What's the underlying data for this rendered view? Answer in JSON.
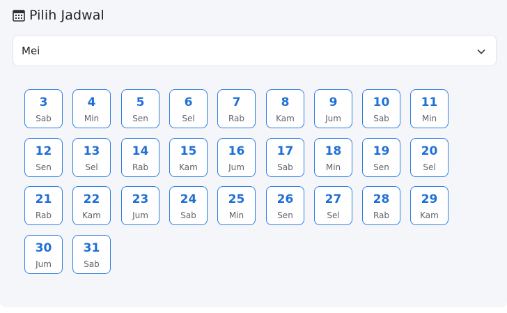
{
  "header": {
    "title": "Pilih Jadwal",
    "icon": "calendar-icon"
  },
  "month_select": {
    "value": "Mei",
    "icon": "chevron-down-icon"
  },
  "days": [
    {
      "date": "3",
      "day": "Sab"
    },
    {
      "date": "4",
      "day": "Min"
    },
    {
      "date": "5",
      "day": "Sen"
    },
    {
      "date": "6",
      "day": "Sel"
    },
    {
      "date": "7",
      "day": "Rab"
    },
    {
      "date": "8",
      "day": "Kam"
    },
    {
      "date": "9",
      "day": "Jum"
    },
    {
      "date": "10",
      "day": "Sab"
    },
    {
      "date": "11",
      "day": "Min"
    },
    {
      "date": "12",
      "day": "Sen"
    },
    {
      "date": "13",
      "day": "Sel"
    },
    {
      "date": "14",
      "day": "Rab"
    },
    {
      "date": "15",
      "day": "Kam"
    },
    {
      "date": "16",
      "day": "Jum"
    },
    {
      "date": "17",
      "day": "Sab"
    },
    {
      "date": "18",
      "day": "Min"
    },
    {
      "date": "19",
      "day": "Sen"
    },
    {
      "date": "20",
      "day": "Sel"
    },
    {
      "date": "21",
      "day": "Rab"
    },
    {
      "date": "22",
      "day": "Kam"
    },
    {
      "date": "23",
      "day": "Jum"
    },
    {
      "date": "24",
      "day": "Sab"
    },
    {
      "date": "25",
      "day": "Min"
    },
    {
      "date": "26",
      "day": "Sen"
    },
    {
      "date": "27",
      "day": "Sel"
    },
    {
      "date": "28",
      "day": "Rab"
    },
    {
      "date": "29",
      "day": "Kam"
    },
    {
      "date": "30",
      "day": "Jum"
    },
    {
      "date": "31",
      "day": "Sab"
    }
  ],
  "colors": {
    "accent": "#1f6fd6",
    "border": "#2f7de1",
    "panel_bg": "#f4f6f9"
  }
}
